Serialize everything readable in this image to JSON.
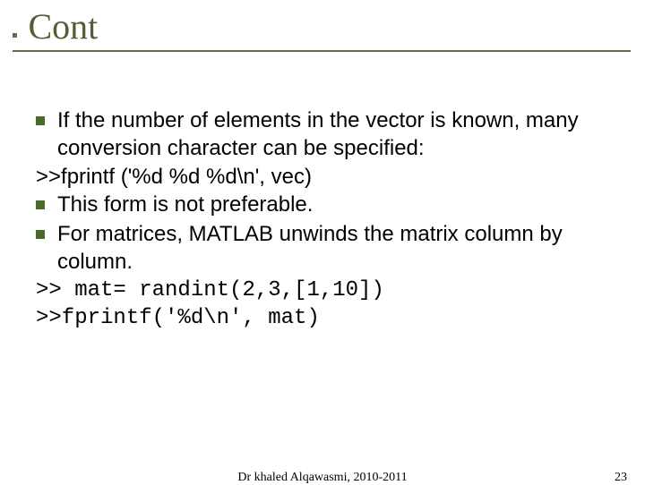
{
  "title": {
    "prefix_bullet": "■",
    "text": "Cont"
  },
  "body": {
    "items": [
      {
        "type": "bullet",
        "text": "If the number of elements in the vector is known, many conversion character can be specified:"
      },
      {
        "type": "line",
        "text": ">>fprintf ('%d %d %d\\n', vec)"
      },
      {
        "type": "bullet",
        "text": "This form is not preferable."
      },
      {
        "type": "bullet",
        "text": "For matrices, MATLAB unwinds the matrix column by column."
      },
      {
        "type": "mono",
        "text": ">> mat= randint(2,3,[1,10])"
      },
      {
        "type": "mono",
        "text": ">>fprintf('%d\\n', mat)"
      }
    ]
  },
  "footer": {
    "center": "Dr khaled Alqawasmi, 2010-2011",
    "page": "23"
  }
}
